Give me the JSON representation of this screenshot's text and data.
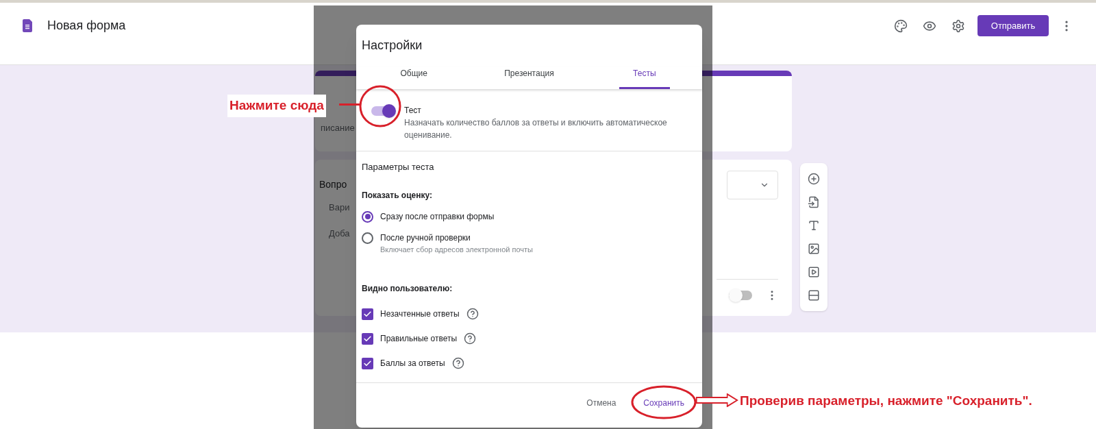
{
  "header": {
    "title": "Новая форма",
    "send_button": "Отправить"
  },
  "background": {
    "description_fragment": "писание",
    "question_fragment": "Вопро",
    "option_fragments": [
      "Вари",
      "Доба"
    ],
    "required_toggle": {
      "on": false
    }
  },
  "dialog": {
    "title": "Настройки",
    "tabs": [
      {
        "label": "Общие",
        "selected": false
      },
      {
        "label": "Презентация",
        "selected": false
      },
      {
        "label": "Тесты",
        "selected": true
      }
    ],
    "quiz_toggle": {
      "label": "Тест",
      "description": "Назначать количество баллов за ответы и включить автоматическое оценивание.",
      "on": true
    },
    "section_title": "Параметры теста",
    "release": {
      "label": "Показать оценку:",
      "options": [
        {
          "label": "Сразу после отправки формы",
          "selected": true
        },
        {
          "label": "После ручной проверки",
          "hint": "Включает сбор адресов электронной почты",
          "selected": false
        }
      ]
    },
    "visibility": {
      "label": "Видно пользователю:",
      "items": [
        {
          "label": "Незачтенные ответы",
          "checked": true
        },
        {
          "label": "Правильные ответы",
          "checked": true
        },
        {
          "label": "Баллы за ответы",
          "checked": true
        }
      ]
    },
    "cancel_button": "Отмена",
    "save_button": "Сохранить"
  },
  "annotations": {
    "toggle_hint": "Нажмите сюда",
    "save_hint": "Проверив параметры, нажмите \"Сохранить\"."
  }
}
